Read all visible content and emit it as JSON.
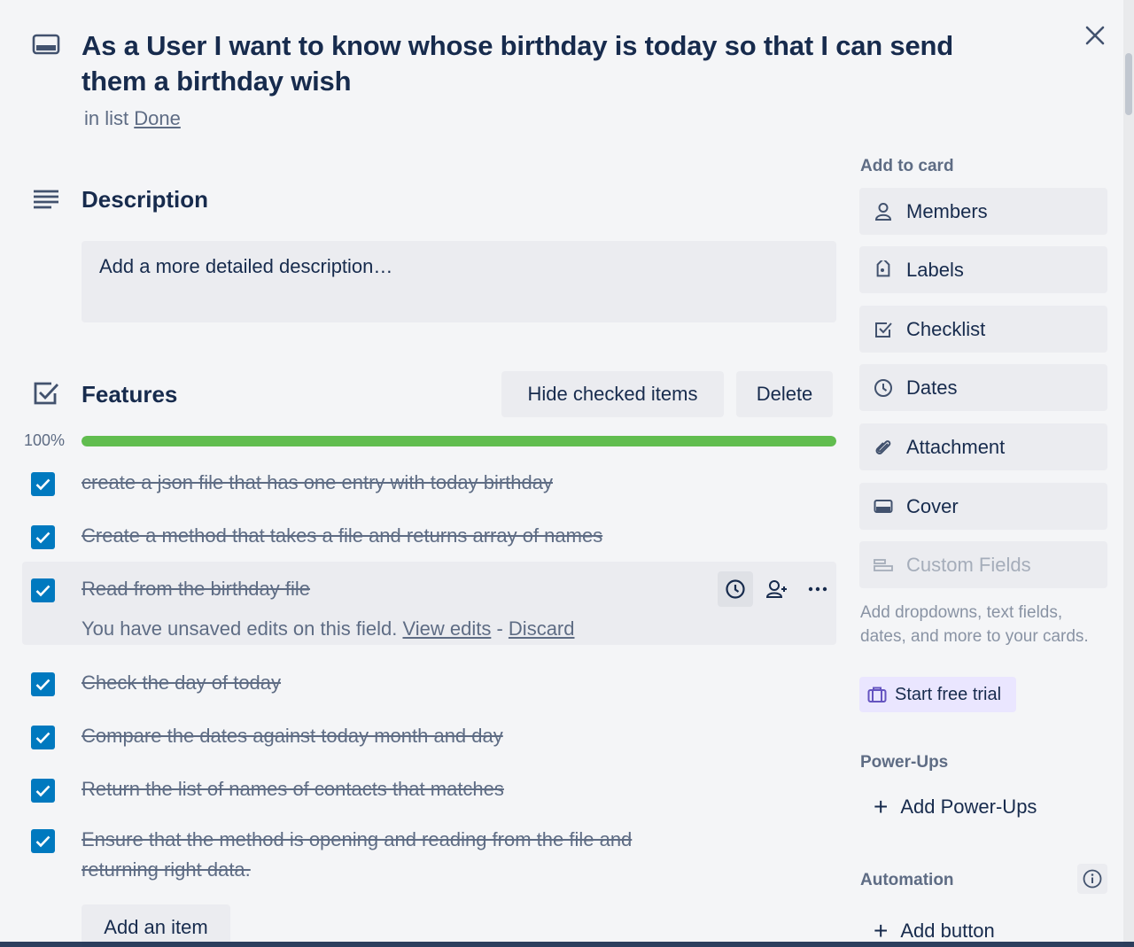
{
  "card": {
    "title": "As a User I want to know whose birthday is today so that I can send them a birthday wish",
    "in_list_prefix": "in list",
    "list_name": "Done",
    "icon": "card-icon"
  },
  "description": {
    "heading": "Description",
    "placeholder": "Add a more detailed description…"
  },
  "checklist": {
    "heading": "Features",
    "hide_checked_label": "Hide checked items",
    "delete_label": "Delete",
    "progress_label": "100%",
    "progress": 1.0,
    "progress_color": "#61bd4f",
    "items": [
      {
        "text": "create a json file that has one entry with today birthday",
        "checked": true
      },
      {
        "text": "Create a method that takes a file and returns array of names",
        "checked": true
      },
      {
        "text": "Read from the birthday file",
        "checked": true
      },
      {
        "text": "Check the day of today",
        "checked": true
      },
      {
        "text": "Compare the dates against today month and day",
        "checked": true
      },
      {
        "text": "Return the list of names of contacts that matches",
        "checked": true
      },
      {
        "text": "Ensure that the method is opening and reading from the file and returning right data.",
        "checked": true
      }
    ],
    "unsaved_notice": {
      "message": "You have unsaved edits on this field.",
      "view_edits": "View edits",
      "separator": "-",
      "discard": "Discard"
    },
    "add_item_label": "Add an item"
  },
  "sidebar": {
    "add_to_card_heading": "Add to card",
    "buttons": [
      {
        "label": "Members",
        "icon": "person-icon"
      },
      {
        "label": "Labels",
        "icon": "tag-icon"
      },
      {
        "label": "Checklist",
        "icon": "checkbox-icon"
      },
      {
        "label": "Dates",
        "icon": "clock-icon"
      },
      {
        "label": "Attachment",
        "icon": "paperclip-icon"
      },
      {
        "label": "Cover",
        "icon": "cover-icon"
      },
      {
        "label": "Custom Fields",
        "icon": "custom-fields-icon",
        "disabled": true
      }
    ],
    "custom_fields_note": "Add dropdowns, text fields, dates, and more to your cards.",
    "trial_label": "Start free trial",
    "powerups_heading": "Power-Ups",
    "add_powerups_label": "Add Power-Ups",
    "automation_heading": "Automation",
    "add_button_label": "Add button"
  },
  "colors": {
    "checkbox": "#0079bf",
    "trial_bg": "#eae6ff",
    "trial_icon": "#6554c0"
  }
}
